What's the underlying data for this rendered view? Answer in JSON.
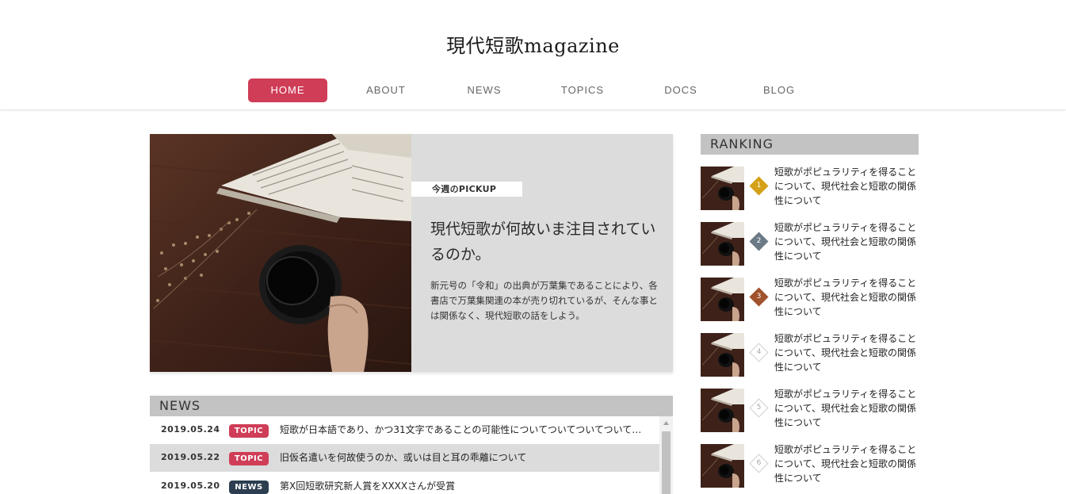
{
  "site": {
    "title": "現代短歌magazine"
  },
  "nav": {
    "items": [
      "HOME",
      "ABOUT",
      "NEWS",
      "TOPICS",
      "DOCS",
      "BLOG"
    ],
    "active": "HOME"
  },
  "pickup": {
    "tag": "今週のPICKUP",
    "title": "現代短歌が何故いま注目されているのか。",
    "text": "新元号の「令和」の出典が万葉集であることにより、各書店で万葉集関連の本が売り切れているが、そんな事とは関係なく、現代短歌の話をしよう。"
  },
  "news": {
    "heading": "NEWS",
    "items": [
      {
        "date": "2019.05.24",
        "badge": "TOPIC",
        "text": "短歌が日本語であり、かつ31文字であることの可能性についてついてついてついて…"
      },
      {
        "date": "2019.05.22",
        "badge": "TOPIC",
        "text": "旧仮名遣いを何故使うのか、或いは目と耳の乖離について"
      },
      {
        "date": "2019.05.20",
        "badge": "NEWS",
        "text": "第X回短歌研究新人賞をXXXXさんが受賞"
      }
    ]
  },
  "ranking": {
    "heading": "RANKING",
    "items": [
      {
        "rank": "1",
        "text": "短歌がポピュラリティを得ることについて、現代社会と短歌の関係性について"
      },
      {
        "rank": "2",
        "text": "短歌がポピュラリティを得ることについて、現代社会と短歌の関係性について"
      },
      {
        "rank": "3",
        "text": "短歌がポピュラリティを得ることについて、現代社会と短歌の関係性について"
      },
      {
        "rank": "4",
        "text": "短歌がポピュラリティを得ることについて、現代社会と短歌の関係性について"
      },
      {
        "rank": "5",
        "text": "短歌がポピュラリティを得ることについて、現代社会と短歌の関係性について"
      },
      {
        "rank": "6",
        "text": "短歌がポピュラリティを得ることについて、現代社会と短歌の関係性について"
      }
    ]
  },
  "colors": {
    "accent": "#cf3d57",
    "topic_badge": "#cf3d57",
    "news_badge": "#2c3e50",
    "rank_gold": "#d4a017",
    "rank_silver": "#6c7a86",
    "rank_bronze": "#a0522d",
    "section_head": "#c3c3c3",
    "panel": "#dcdcdc"
  },
  "icons": {
    "pickup_image": "book-coffee-photo",
    "rank_thumb": "book-coffee-thumbnail",
    "rank_marker": "diamond-rank-icon",
    "scroll_up": "triangle-up-icon"
  }
}
